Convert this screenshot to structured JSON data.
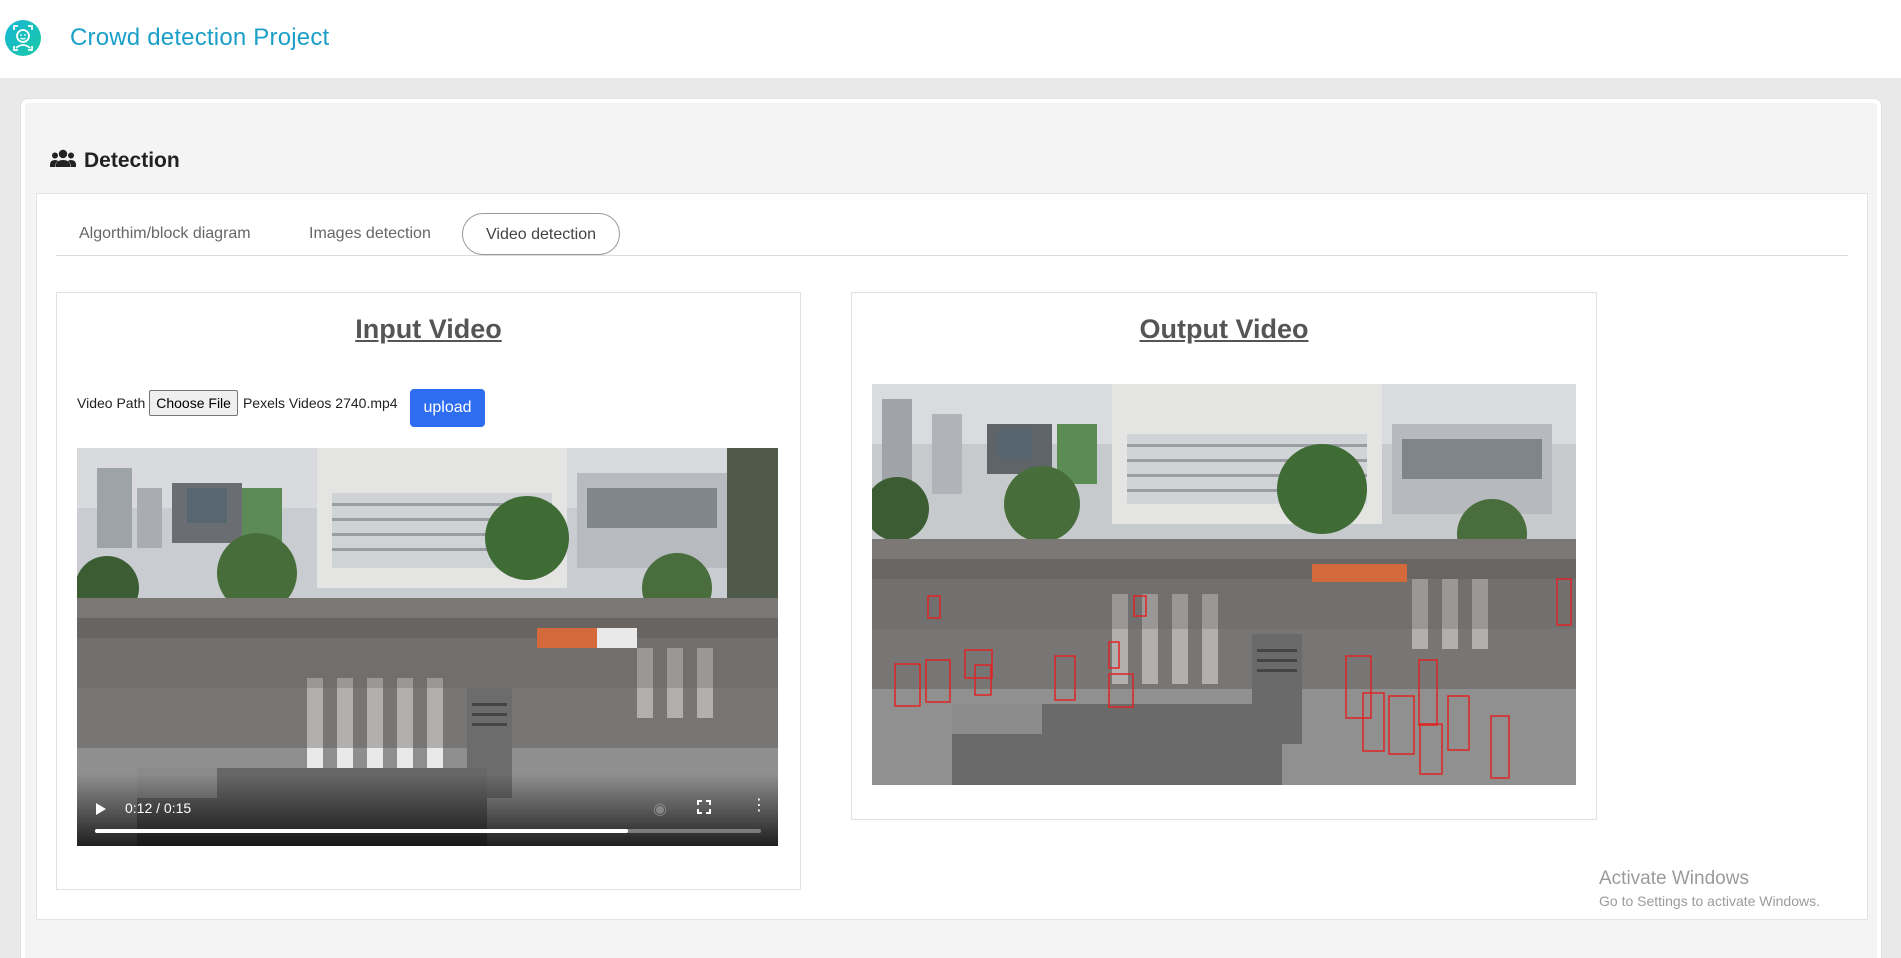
{
  "app": {
    "title": "Crowd detection Project"
  },
  "section": {
    "title": "Detection"
  },
  "tabs": [
    {
      "label": "Algorthim/block diagram"
    },
    {
      "label": "Images detection"
    },
    {
      "label": "Video detection"
    }
  ],
  "input_panel": {
    "title": "Input Video",
    "file_label": "Video Path",
    "choose_button": "Choose File",
    "file_name": "Pexels Videos 2740.mp4",
    "upload_button": "upload",
    "player": {
      "time": "0:12 / 0:15",
      "progress": 0.8
    }
  },
  "output_panel": {
    "title": "Output Video"
  },
  "watermark": {
    "title": "Activate Windows",
    "subtitle": "Go to Settings to activate Windows."
  },
  "colors": {
    "brand": "#1a9fc9",
    "upload": "#2f6df0",
    "detection_box": "#e02424"
  }
}
